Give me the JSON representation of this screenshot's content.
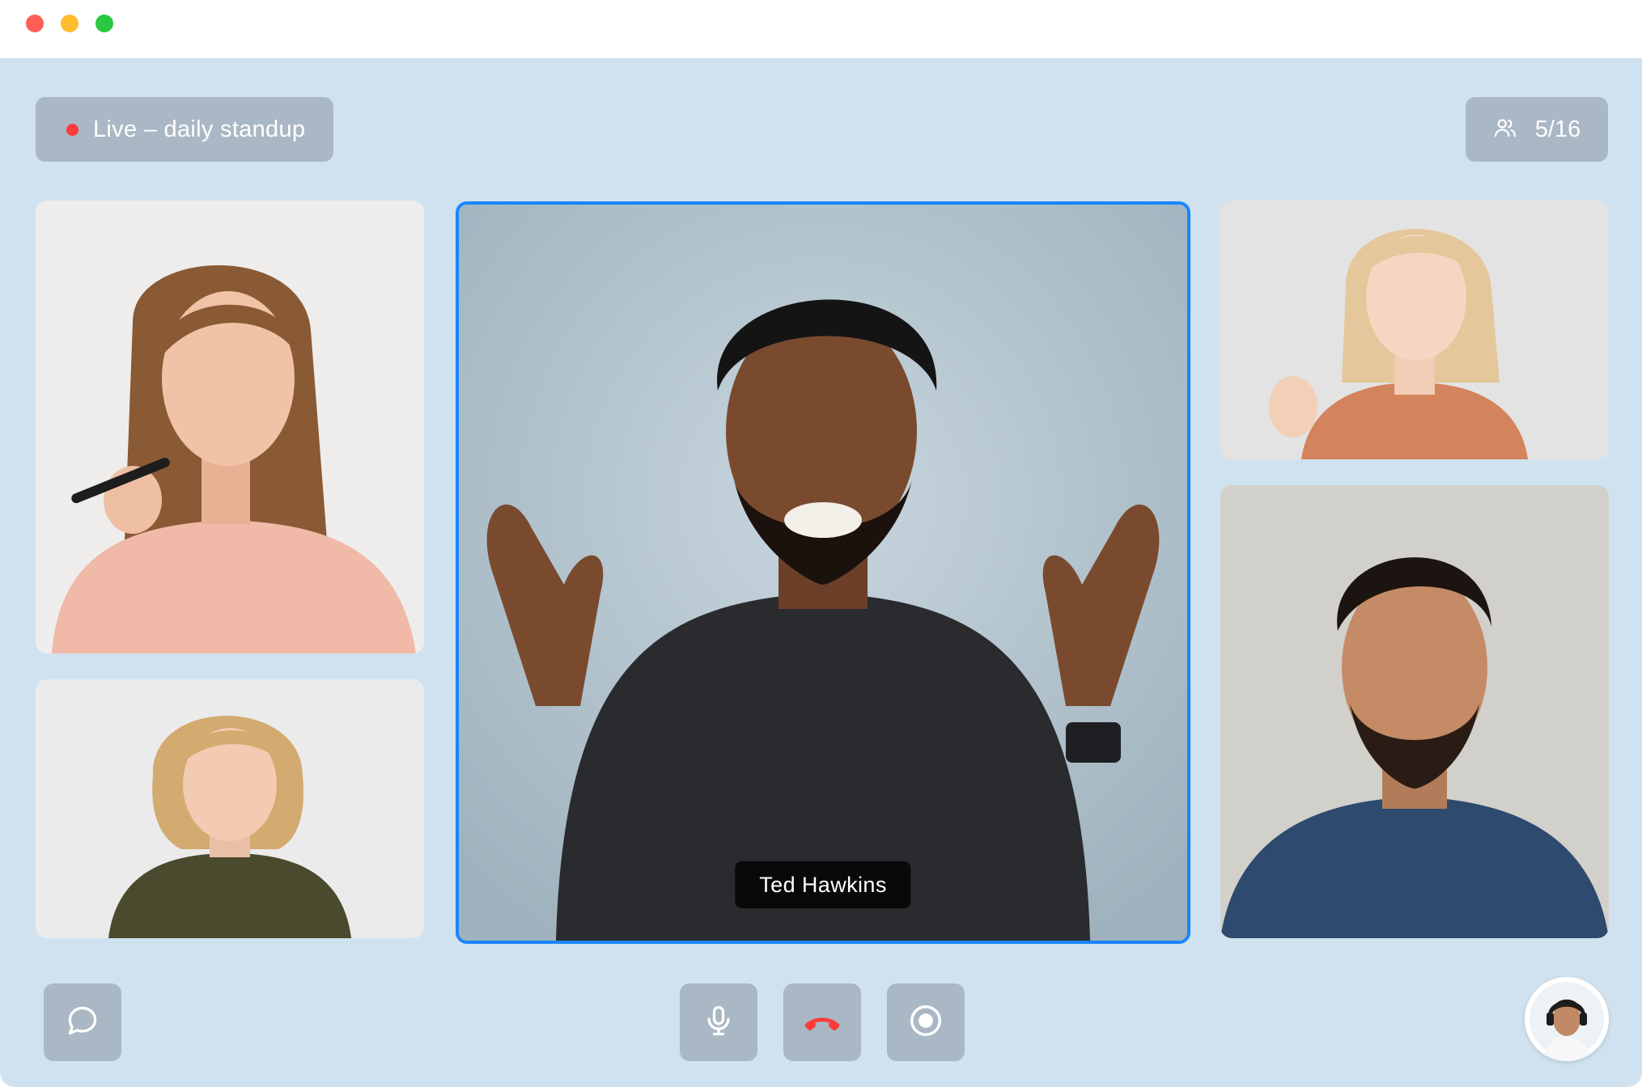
{
  "window": {
    "controls": [
      "close",
      "minimize",
      "maximize"
    ]
  },
  "meeting": {
    "status_label": "Live – daily standup",
    "participant_count": "5/16"
  },
  "participants": [
    {
      "tile": "left-top",
      "role": "participant"
    },
    {
      "tile": "left-bottom",
      "role": "participant"
    },
    {
      "tile": "center",
      "role": "active-speaker",
      "name": "Ted Hawkins"
    },
    {
      "tile": "right-top",
      "role": "participant"
    },
    {
      "tile": "right-bottom",
      "role": "participant"
    }
  ],
  "controls": {
    "chat": "chat-icon",
    "mic": "microphone-icon",
    "hangup": "phone-hangup-icon",
    "record": "record-icon",
    "self": "self-avatar"
  },
  "colors": {
    "stage_bg": "#d0e2ef",
    "pill_bg": "#a9b8c4",
    "live_dot": "#ff3b3b",
    "active_border": "#1a85ff",
    "hangup_red": "#ff3b3b"
  }
}
